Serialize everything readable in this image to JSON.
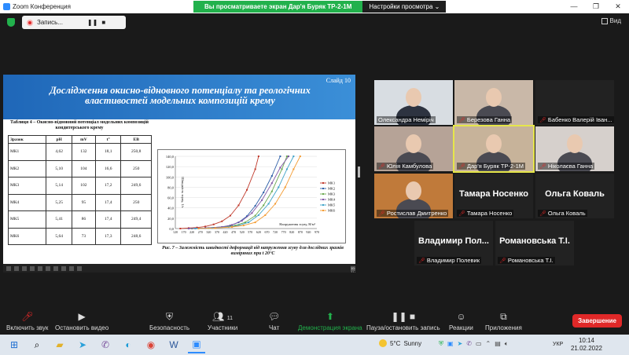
{
  "window": {
    "app_title": "Zoom Конференция",
    "banner_message": "Вы просматриваете экран Дар'я Буряк ТР-2-1М",
    "banner_options": "Настройки просмотра ⌄",
    "controls": [
      "—",
      "❐",
      "✕"
    ]
  },
  "topbar": {
    "recording_label": "Запись...",
    "pause_glyph": "❚❚",
    "stop_glyph": "■",
    "view_label": "Вид"
  },
  "slide": {
    "number": "Слайд 10",
    "title": "Дослідження окисно-відновного потенціалу та реологічних властивостей модельних композицій крему",
    "table_caption": "Таблиця 4 – Окисно-відновний потенціал модельних композицій кондитерського крему",
    "table_headers": [
      "Зразок",
      "pH",
      "mV",
      "t°",
      "EB"
    ],
    "table_rows": [
      [
        "МК1",
        "4,62",
        "132",
        "18,1",
        "250,8"
      ],
      [
        "МК2",
        "5,10",
        "104",
        "16,6",
        "250"
      ],
      [
        "МК3",
        "5,14",
        "102",
        "17,2",
        "249,6"
      ],
      [
        "МК4",
        "5,25",
        "95",
        "17,4",
        "250"
      ],
      [
        "МК5",
        "5,41",
        "86",
        "17,4",
        "249,4"
      ],
      [
        "МК6",
        "5,64",
        "73",
        "17,3",
        "248,6"
      ]
    ],
    "figure_caption": "Рис. 7 – Залежність швидкості деформації від напруження зсуву для дослідних зразків виміряних при t 20°С",
    "slide_clock": "10:14 21.02.2022"
  },
  "chart_data": {
    "type": "line",
    "ylabel": "Швидкість зсуву, 1/с",
    "xlabel": "Напруження зсуву, Н/м²",
    "x_ticks": [
      120,
      170,
      220,
      270,
      320,
      370,
      420,
      470,
      520,
      570,
      620,
      670,
      720,
      770,
      820,
      870,
      920,
      970
    ],
    "y_ticks": [
      "0,0",
      "20,0",
      "40,0",
      "60,0",
      "80,0",
      "100,0",
      "120,0",
      "140,0"
    ],
    "xlim": [
      120,
      970
    ],
    "ylim": [
      0,
      140
    ],
    "series": [
      {
        "name": "МК1",
        "color": "#c0392b",
        "x": [
          150,
          200,
          250,
          300,
          350,
          400,
          450,
          500,
          550,
          600,
          620
        ],
        "y": [
          0,
          1,
          2,
          4,
          8,
          14,
          25,
          45,
          75,
          115,
          140
        ]
      },
      {
        "name": "МК2",
        "color": "#2e5fa8",
        "x": [
          200,
          300,
          400,
          450,
          500,
          550,
          600,
          650,
          700,
          750
        ],
        "y": [
          0,
          1,
          3,
          6,
          12,
          24,
          44,
          70,
          102,
          140
        ]
      },
      {
        "name": "МК3",
        "color": "#6aa84f",
        "x": [
          220,
          320,
          420,
          480,
          540,
          600,
          650,
          700,
          760,
          790
        ],
        "y": [
          0,
          1,
          3,
          6,
          12,
          25,
          45,
          72,
          115,
          140
        ]
      },
      {
        "name": "МК4",
        "color": "#7f56a6",
        "x": [
          200,
          300,
          400,
          460,
          520,
          580,
          640,
          700,
          750,
          800
        ],
        "y": [
          0,
          1,
          3,
          7,
          15,
          30,
          55,
          88,
          118,
          140
        ]
      },
      {
        "name": "МК5",
        "color": "#3fa3c8",
        "x": [
          240,
          340,
          440,
          500,
          560,
          620,
          680,
          740,
          790,
          830
        ],
        "y": [
          0,
          1,
          3,
          6,
          12,
          26,
          48,
          80,
          115,
          140
        ]
      },
      {
        "name": "МК6",
        "color": "#f39c33",
        "x": [
          260,
          360,
          460,
          530,
          600,
          660,
          720,
          780,
          830,
          870
        ],
        "y": [
          0,
          1,
          3,
          6,
          12,
          26,
          48,
          80,
          115,
          140
        ]
      }
    ]
  },
  "participants": [
    {
      "name": "Олександра Неміріч",
      "muted": false,
      "video": true,
      "bg": "#d8dde2"
    },
    {
      "name": "Березова Ганна",
      "muted": true,
      "video": true,
      "bg": "#c9b8a8"
    },
    {
      "name": "Бабенко Валерій Іван...",
      "muted": true,
      "video": false,
      "bg": "#222"
    },
    {
      "name": "Юлія Камбулова",
      "muted": true,
      "video": true,
      "bg": "#b6a397"
    },
    {
      "name": "Дар'я Буряк ТР-2-1М",
      "muted": true,
      "video": true,
      "bg": "#c7b39a"
    },
    {
      "name": "Ніколаєва Ганна",
      "muted": true,
      "video": true,
      "bg": "#d6d0cc"
    },
    {
      "name": "Ростислав Дмитренко",
      "muted": true,
      "video": true,
      "bg": "#c07a3a"
    },
    {
      "name": "Тамара Носенко",
      "muted": true,
      "video": false,
      "big": "Тамара Носенко"
    },
    {
      "name": "Ольга Коваль",
      "muted": true,
      "video": false,
      "big": "Ольга Коваль"
    },
    {
      "name": "Владимир Полевик",
      "muted": true,
      "video": false,
      "big": "Владимир  Пол..."
    },
    {
      "name": "Романовська Т.І.",
      "muted": true,
      "video": false,
      "big": "Романовська Т.І."
    }
  ],
  "toolbar": {
    "unmute": "Включить звук",
    "stop_video": "Остановить видео",
    "security": "Безопасность",
    "participants": "Участники",
    "participants_count": "11",
    "chat": "Чат",
    "share": "Демонстрация экрана",
    "pause_recording": "Пауза/остановить запись",
    "reactions": "Реакции",
    "apps": "Приложения",
    "end": "Завершение"
  },
  "taskbar": {
    "temperature": "5°C",
    "weather": "Sunny",
    "language": "УКР",
    "time": "10:14",
    "date": "21.02.2022"
  }
}
